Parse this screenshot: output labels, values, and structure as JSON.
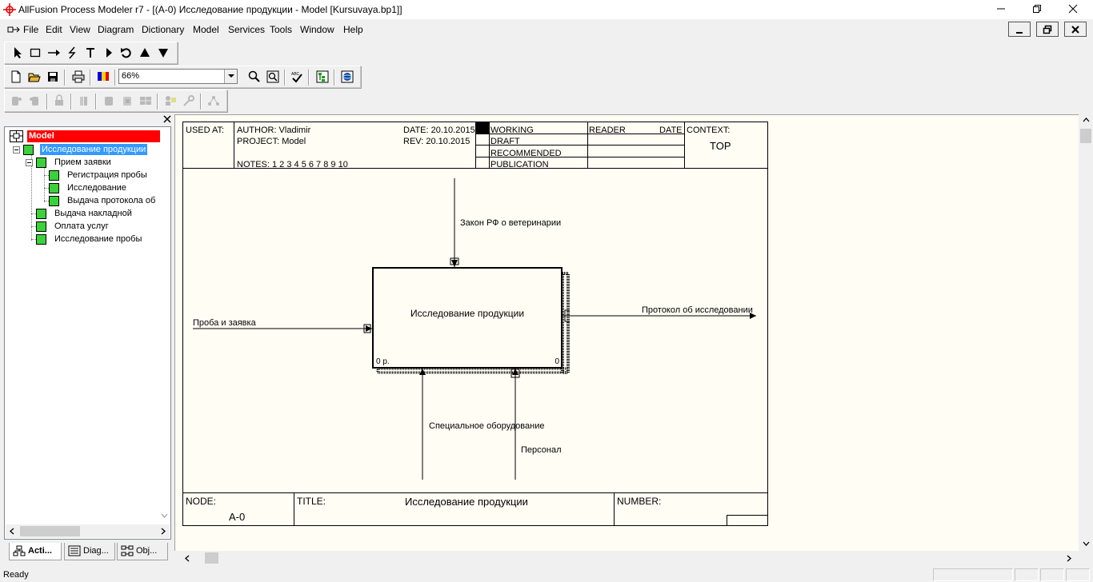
{
  "window": {
    "title": "AllFusion Process Modeler r7 - [(A-0) Исследование продукции - Model  [Kursuvaya.bp1]]"
  },
  "menu": [
    "File",
    "Edit",
    "View",
    "Diagram",
    "Dictionary",
    "Model",
    "Services",
    "Tools",
    "Window",
    "Help"
  ],
  "toolbar": {
    "zoom_value": "66%"
  },
  "tree": {
    "root": "Model",
    "selected": "Исследование продукции",
    "children": [
      "Прием заявки",
      "Регистрация пробы",
      "Исследование",
      "Выдача протокола об",
      "Выдача накладной",
      "Оплата услуг",
      "Исследование пробы"
    ]
  },
  "tabs": [
    "Acti...",
    "Diag...",
    "Obj..."
  ],
  "diagram": {
    "header": {
      "used_at": "USED AT:",
      "author": "AUTHOR:  Vladimir",
      "project": "PROJECT:  Model",
      "notes": "NOTES:  1  2  3  4  5  6  7  8  9  10",
      "date": "DATE: 20.10.2015",
      "rev": "REV:   20.10.2015",
      "status": [
        "WORKING",
        "DRAFT",
        "RECOMMENDED",
        "PUBLICATION"
      ],
      "reader": "READER",
      "date2": "DATE",
      "context_label": "CONTEXT:",
      "context_value": "TOP"
    },
    "activity": {
      "name": "Исследование продукции",
      "cost": "0 р.",
      "number": "0"
    },
    "arrows": {
      "control": "Закон РФ о ветеринарии",
      "input": "Проба и заявка",
      "output": "Протокол об исследовании",
      "mechanism1": "Специальное оборудование",
      "mechanism2": "Персонал"
    },
    "footer": {
      "node_label": "NODE:",
      "node_value": "A-0",
      "title_label": "TITLE:",
      "title_value": "Исследование продукции",
      "number_label": "NUMBER:"
    }
  },
  "status": {
    "text": "Ready"
  }
}
